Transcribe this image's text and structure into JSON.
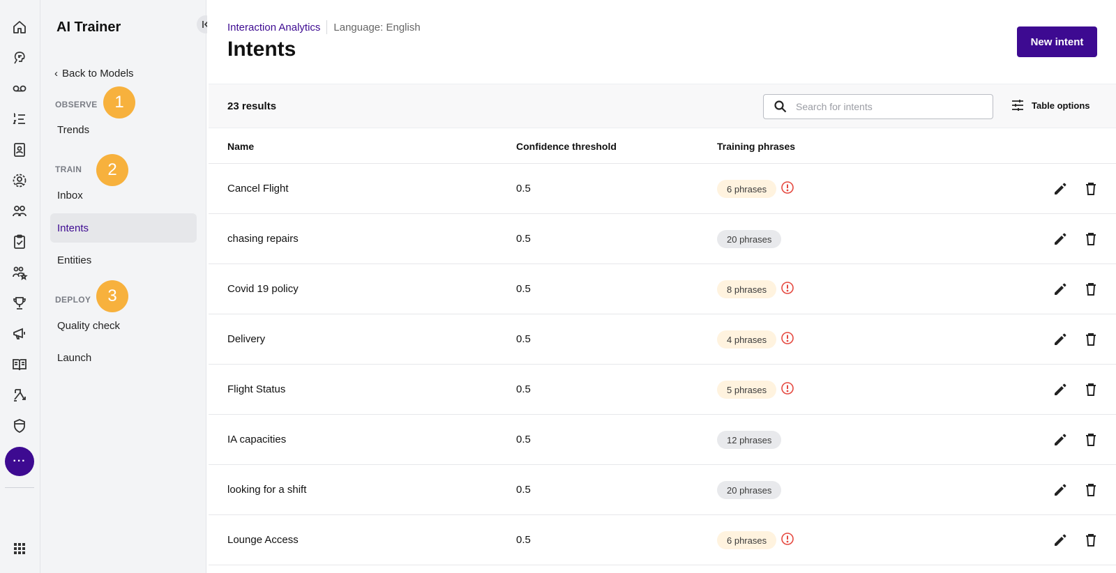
{
  "app": {
    "title": "AI Trainer"
  },
  "rail": {
    "icons": [
      "home-icon",
      "brain-head-icon",
      "voicemail-icon",
      "numbered-list-icon",
      "contact-book-icon",
      "agent-circle-icon",
      "people-group-icon",
      "clipboard-check-icon",
      "people-star-icon",
      "trophy-icon",
      "megaphone-icon",
      "open-book-icon",
      "flow-arrows-icon",
      "shield-icon"
    ],
    "more_label": "···",
    "apps_icon": "apps-grid-icon"
  },
  "sidebar": {
    "back_label": "Back to Models",
    "sections": {
      "observe": {
        "label": "OBSERVE",
        "badge": "1"
      },
      "train": {
        "label": "TRAIN",
        "badge": "2"
      },
      "deploy": {
        "label": "DEPLOY",
        "badge": "3"
      }
    },
    "items": {
      "trends": "Trends",
      "inbox": "Inbox",
      "intents": "Intents",
      "entities": "Entities",
      "quality_check": "Quality check",
      "launch": "Launch"
    },
    "active_item": "Intents"
  },
  "header": {
    "breadcrumb": "Interaction Analytics",
    "language": "Language: English",
    "title": "Intents",
    "new_button": "New intent"
  },
  "toolbar": {
    "results": "23 results",
    "search_placeholder": "Search for intents",
    "table_options": "Table options"
  },
  "table": {
    "columns": [
      "Name",
      "Confidence threshold",
      "Training phrases"
    ],
    "rows": [
      {
        "name": "Cancel Flight",
        "confidence": "0.5",
        "phrases": "6 phrases",
        "warning": true
      },
      {
        "name": "chasing repairs",
        "confidence": "0.5",
        "phrases": "20 phrases",
        "warning": false
      },
      {
        "name": "Covid 19 policy",
        "confidence": "0.5",
        "phrases": "8 phrases",
        "warning": true
      },
      {
        "name": "Delivery",
        "confidence": "0.5",
        "phrases": "4 phrases",
        "warning": true
      },
      {
        "name": "Flight Status",
        "confidence": "0.5",
        "phrases": "5 phrases",
        "warning": true
      },
      {
        "name": "IA capacities",
        "confidence": "0.5",
        "phrases": "12 phrases",
        "warning": false
      },
      {
        "name": "looking for a shift",
        "confidence": "0.5",
        "phrases": "20 phrases",
        "warning": false
      },
      {
        "name": "Lounge Access",
        "confidence": "0.5",
        "phrases": "6 phrases",
        "warning": true
      }
    ]
  },
  "colors": {
    "brand": "#3d0a91",
    "badge": "#f7b13d",
    "warning": "#e5483f",
    "pill_warn": "#fff3df",
    "pill_ok": "#e8e9ec"
  }
}
